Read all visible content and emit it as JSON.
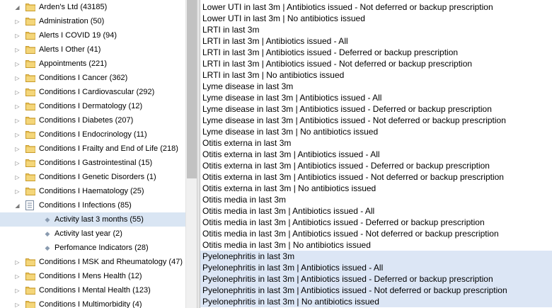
{
  "tree": {
    "items": [
      {
        "label": "Arden's Ltd (43185)",
        "icon": "folder-icon",
        "expander": "open"
      },
      {
        "label": "Administration (50)",
        "icon": "folder-icon",
        "expander": "closed"
      },
      {
        "label": "Alerts I COVID 19 (94)",
        "icon": "folder-icon",
        "expander": "closed"
      },
      {
        "label": "Alerts I Other (41)",
        "icon": "folder-icon",
        "expander": "closed"
      },
      {
        "label": "Appointments (221)",
        "icon": "folder-icon",
        "expander": "closed"
      },
      {
        "label": "Conditions I Cancer (362)",
        "icon": "folder-icon",
        "expander": "closed"
      },
      {
        "label": "Conditions I Cardiovascular (292)",
        "icon": "folder-icon",
        "expander": "closed"
      },
      {
        "label": "Conditions I Dermatology (12)",
        "icon": "folder-icon",
        "expander": "closed"
      },
      {
        "label": "Conditions I Diabetes (207)",
        "icon": "folder-icon",
        "expander": "closed"
      },
      {
        "label": "Conditions I Endocrinology (11)",
        "icon": "folder-icon",
        "expander": "closed"
      },
      {
        "label": "Conditions I Frailty and End of Life (218)",
        "icon": "folder-icon",
        "expander": "closed"
      },
      {
        "label": "Conditions I Gastrointestinal (15)",
        "icon": "folder-icon",
        "expander": "closed"
      },
      {
        "label": "Conditions I Genetic Disorders (1)",
        "icon": "folder-icon",
        "expander": "closed"
      },
      {
        "label": "Conditions I Haematology (25)",
        "icon": "folder-icon",
        "expander": "closed"
      },
      {
        "label": "Conditions I Infections (85)",
        "icon": "document-icon",
        "expander": "open"
      },
      {
        "label": "Activity last 3 months (55)",
        "icon": "bullet-icon",
        "expander": "none"
      },
      {
        "label": "Activity last year (2)",
        "icon": "bullet-icon",
        "expander": "none"
      },
      {
        "label": "Perfomance Indicators (28)",
        "icon": "bullet-icon",
        "expander": "none"
      },
      {
        "label": "Conditions I MSK and Rheumatology (47)",
        "icon": "folder-icon",
        "expander": "closed"
      },
      {
        "label": "Conditions I Mens Health (12)",
        "icon": "folder-icon",
        "expander": "closed"
      },
      {
        "label": "Conditions I Mental Health (123)",
        "icon": "folder-icon",
        "expander": "closed"
      },
      {
        "label": "Conditions I Multimorbidity (4)",
        "icon": "folder-icon",
        "expander": "closed"
      }
    ],
    "selected_label": "Activity last 3 months (55)"
  },
  "list": {
    "items": [
      "Lower UTI in last 3m | Antibiotics issued - Not deferred or backup prescription",
      "Lower UTI in last 3m | No antibiotics issued",
      "LRTI in last 3m",
      "LRTI in last 3m | Antibiotics issued - All",
      "LRTI in last 3m | Antibiotics issued - Deferred or backup prescription",
      "LRTI in last 3m | Antibiotics issued - Not deferred or backup prescription",
      "LRTI in last 3m | No antibiotics issued",
      "Lyme disease in last 3m",
      "Lyme disease in last 3m | Antibiotics issued - All",
      "Lyme disease in last 3m | Antibiotics issued - Deferred or backup prescription",
      "Lyme disease in last 3m | Antibiotics issued - Not deferred or backup prescription",
      "Lyme disease in last 3m | No antibiotics issued",
      "Otitis externa in last 3m",
      "Otitis externa in last 3m | Antibiotics issued - All",
      "Otitis externa in last 3m | Antibiotics issued - Deferred or backup prescription",
      "Otitis externa in last 3m | Antibiotics issued - Not deferred or backup prescription",
      "Otitis externa in last 3m | No antibiotics issued",
      "Otitis media in last 3m",
      "Otitis media in last 3m | Antibiotics issued - All",
      "Otitis media in last 3m | Antibiotics issued - Deferred or backup prescription",
      "Otitis media in last 3m | Antibiotics issued - Not deferred or backup prescription",
      "Otitis media in last 3m | No antibiotics issued",
      "Pyelonephritis in last 3m",
      "Pyelonephritis in last 3m | Antibiotics issued - All",
      "Pyelonephritis in last 3m | Antibiotics issued - Deferred or backup prescription",
      "Pyelonephritis in last 3m | Antibiotics issued - Not deferred or backup prescription",
      "Pyelonephritis in last 3m | No antibiotics issued"
    ],
    "selected_items": [
      "Pyelonephritis in last 3m",
      "Pyelonephritis in last 3m | Antibiotics issued - All",
      "Pyelonephritis in last 3m | Antibiotics issued - Deferred or backup prescription",
      "Pyelonephritis in last 3m | Antibiotics issued - Not deferred or backup prescription",
      "Pyelonephritis in last 3m | No antibiotics issued"
    ]
  },
  "colors": {
    "selection": "#d9e5f3",
    "folder": "#e8c25a",
    "scrollbar_thumb": "#c2c2c2"
  }
}
